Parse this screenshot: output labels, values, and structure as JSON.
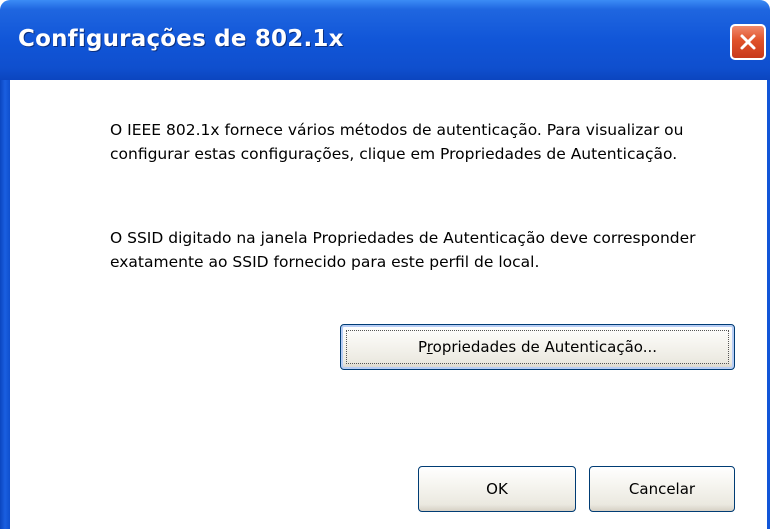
{
  "window": {
    "title": "Configurações de 802.1x"
  },
  "content": {
    "paragraph1": "O IEEE 802.1x fornece vários métodos de autenticação. Para visualizar ou configurar estas configurações, clique em Propriedades de Autenticação.",
    "paragraph2": "O SSID digitado na janela Propriedades de Autenticação deve corresponder exatamente ao SSID fornecido para este perfil de local."
  },
  "buttons": {
    "auth_properties": {
      "prefix": "P",
      "mnemonic": "r",
      "suffix": "opriedades de Autenticação..."
    },
    "ok_label": "OK",
    "cancel_label": "Cancelar"
  },
  "icons": {
    "close": "close-icon"
  },
  "colors": {
    "titlebar": "#1156d8",
    "close_button": "#e0522a",
    "button_border": "#003c74"
  }
}
